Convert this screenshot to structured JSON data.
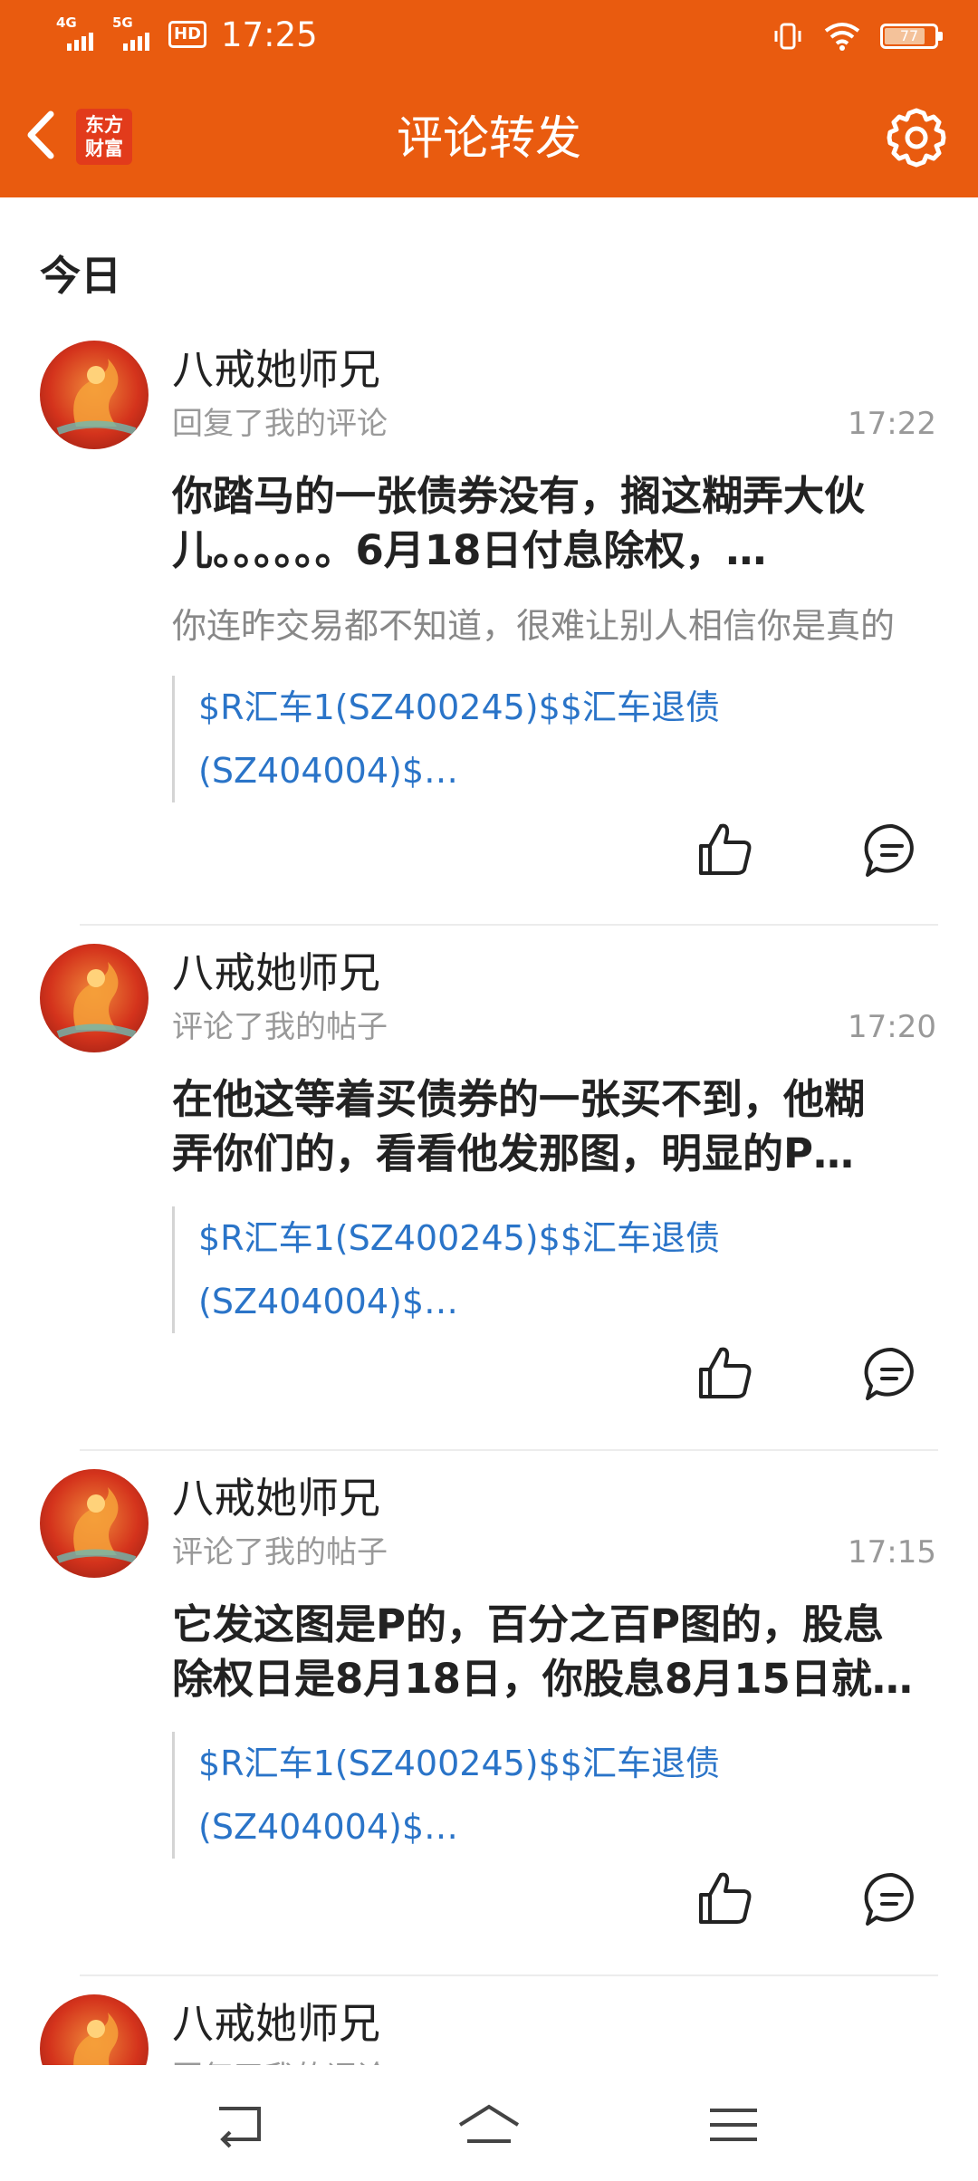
{
  "status_bar": {
    "net1": "4G",
    "net2": "5G",
    "hd": "HD",
    "time": "17:25",
    "battery": "77"
  },
  "header": {
    "logo_line1": "东方",
    "logo_line2": "财富",
    "title": "评论转发"
  },
  "section": {
    "title": "今日"
  },
  "items": [
    {
      "name": "八戒她师兄",
      "action": "回复了我的评论",
      "time": "17:22",
      "content_line1": "你踏马的一张债券没有，搁这糊弄大伙",
      "content_line2": "儿。。。。。。6月18日付息除权，…",
      "quote": "你连昨交易都不知道，很难让别人相信你是真的",
      "ref_line1": "$R汇车1(SZ400245)$$汇车退债",
      "ref_line2": "(SZ404004)$…"
    },
    {
      "name": "八戒她师兄",
      "action": "评论了我的帖子",
      "time": "17:20",
      "content_line1": "在他这等着买债券的一张买不到，他糊",
      "content_line2": "弄你们的，看看他发那图，明显的P…",
      "ref_line1": "$R汇车1(SZ400245)$$汇车退债",
      "ref_line2": "(SZ404004)$…"
    },
    {
      "name": "八戒她师兄",
      "action": "评论了我的帖子",
      "time": "17:15",
      "content_line1": "它发这图是P的，百分之百P图的，股息",
      "content_line2": "除权日是8月18日，你股息8月15日就…",
      "ref_line1": "$R汇车1(SZ400245)$$汇车退债",
      "ref_line2": "(SZ404004)$…"
    },
    {
      "name": "八戒她师兄",
      "action": "回复了我的评论"
    }
  ],
  "colors": {
    "brand": "#e95b0f",
    "link": "#2a74c8",
    "muted": "#999999"
  }
}
